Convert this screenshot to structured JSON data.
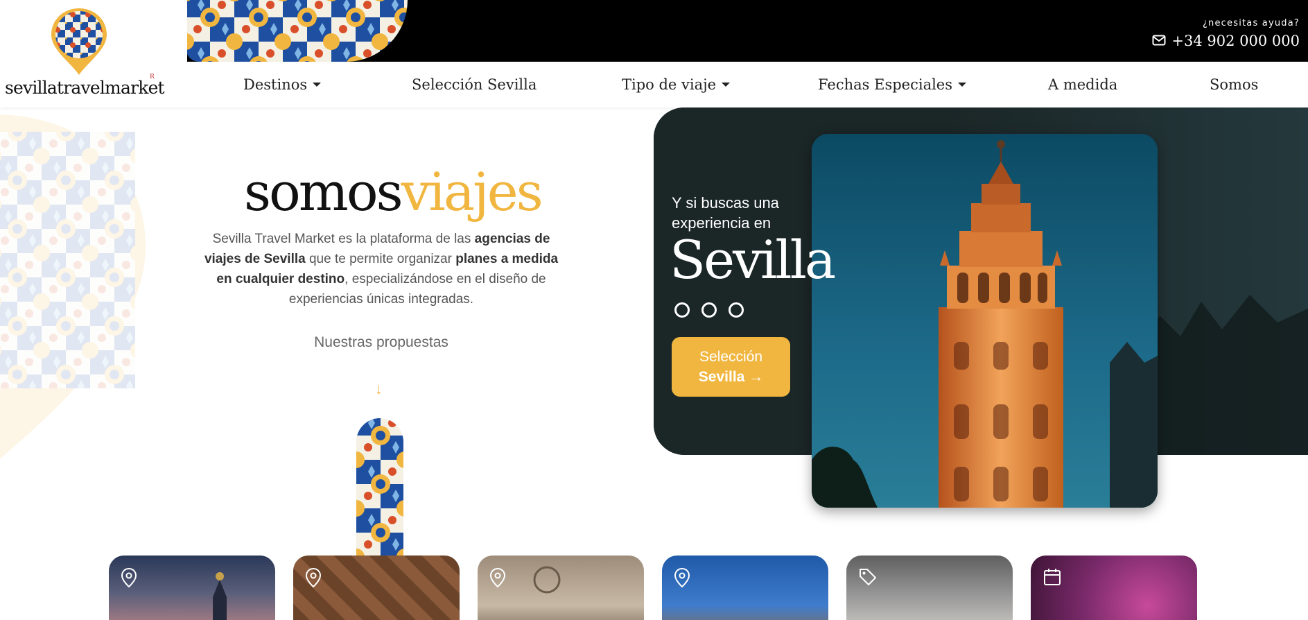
{
  "header": {
    "help_label": "¿necesitas ayuda?",
    "phone": "+34 902 000 000",
    "mail_icon": "envelope-icon"
  },
  "logo": {
    "text": "sevillatravelmarket",
    "mark": "R"
  },
  "nav": {
    "items": [
      {
        "label": "Destinos",
        "dropdown": true
      },
      {
        "label": "Selección Sevilla",
        "dropdown": false
      },
      {
        "label": "Tipo de viaje",
        "dropdown": true
      },
      {
        "label": "Fechas Especiales",
        "dropdown": true
      },
      {
        "label": "A medida",
        "dropdown": false
      },
      {
        "label": "Somos",
        "dropdown": false
      }
    ]
  },
  "hero": {
    "title_main": "somos",
    "title_accent": "viajes",
    "desc_1": "Sevilla Travel Market es la plataforma de las ",
    "desc_b1": "agencias de viajes de Sevilla",
    "desc_2": " que te permite organizar ",
    "desc_b2": "planes a medida en cualquier destino",
    "desc_3": ", especializándose en el diseño de experiencias únicas integradas.",
    "proposals": "Nuestras propuestas",
    "arrow": "↓"
  },
  "featured": {
    "subtitle": "Y si buscas una experiencia en",
    "city": "Sevilla",
    "slide_count": 3,
    "cta_line1": "Selección",
    "cta_line2": "Sevilla",
    "cta_arrow": "→"
  },
  "cards": [
    {
      "icon": "location-pin-icon"
    },
    {
      "icon": "location-pin-icon"
    },
    {
      "icon": "location-pin-icon"
    },
    {
      "icon": "location-pin-icon"
    },
    {
      "icon": "price-tag-icon"
    },
    {
      "icon": "calendar-icon"
    }
  ],
  "colors": {
    "accent": "#f1b63f",
    "dark_card": "#1b2627",
    "topbar": "#000000",
    "tile_blue": "#1f4fa0"
  }
}
